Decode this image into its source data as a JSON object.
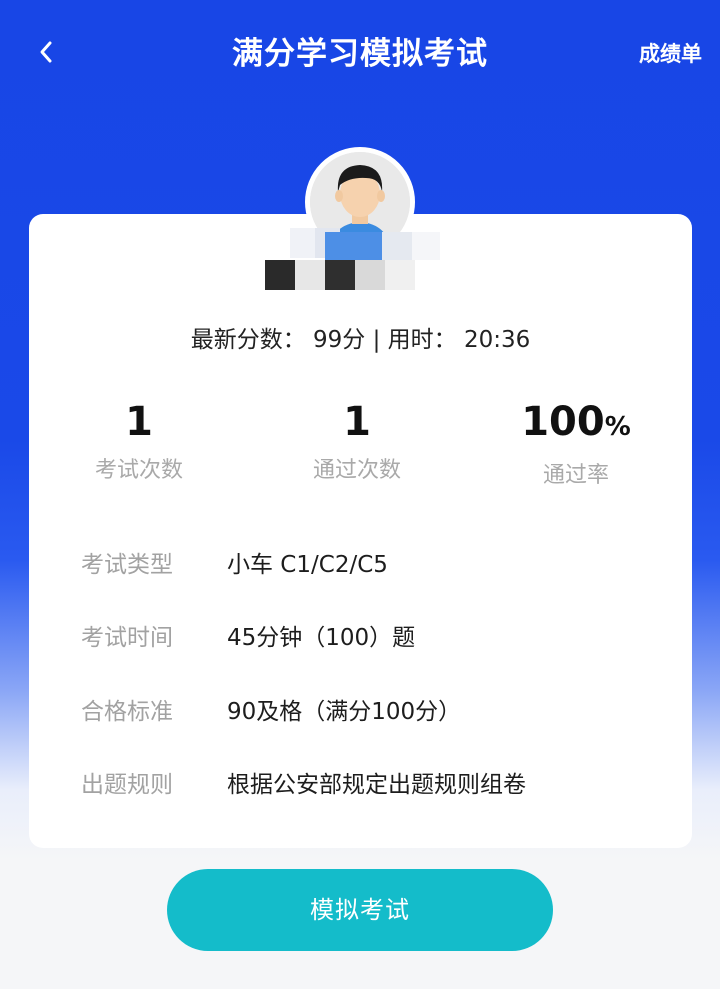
{
  "header": {
    "title": "满分学习模拟考试",
    "right_link": "成绩单"
  },
  "summary": {
    "latest_label": "最新分数",
    "latest_score": "99分",
    "separator": "|",
    "time_label": "用时",
    "time_value": "20:36"
  },
  "stats": [
    {
      "value": "1",
      "label": "考试次数"
    },
    {
      "value": "1",
      "label": "通过次数"
    },
    {
      "value": "100",
      "unit": "%",
      "label": "通过率"
    }
  ],
  "info": [
    {
      "key": "考试类型",
      "value": "小车 C1/C2/C5"
    },
    {
      "key": "考试时间",
      "value": "45分钟（100）题"
    },
    {
      "key": "合格标准",
      "value": "90及格（满分100分）"
    },
    {
      "key": "出题规则",
      "value": "根据公安部规定出题规则组卷"
    }
  ],
  "action": {
    "button_label": "模拟考试"
  },
  "colors": {
    "header_blue": "#1846e6",
    "button_teal": "#14bcca"
  },
  "icons": {
    "back": "chevron-left-icon",
    "avatar": "user-avatar"
  }
}
